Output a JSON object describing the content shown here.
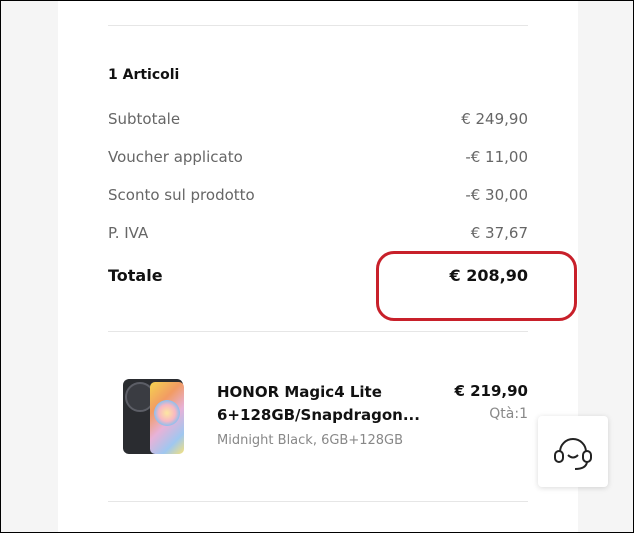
{
  "summary": {
    "items_count": "1 Articoli",
    "rows": [
      {
        "label": "Subtotale",
        "value": "€ 249,90"
      },
      {
        "label": "Voucher applicato",
        "value": "-€ 11,00"
      },
      {
        "label": "Sconto sul prodotto",
        "value": "-€ 30,00"
      },
      {
        "label": "P. IVA",
        "value": "€ 37,67"
      }
    ],
    "total_label": "Totale",
    "total_value": "€ 208,90",
    "highlight_color": "#c8202a"
  },
  "product": {
    "name_line1": "HONOR Magic4 Lite",
    "name_line2": "6+128GB/Snapdragon...",
    "variant": "Midnight Black, 6GB+128GB",
    "price": "€ 219,90",
    "quantity": "Qtà:1"
  },
  "support_widget": {
    "icon": "headset-icon"
  }
}
